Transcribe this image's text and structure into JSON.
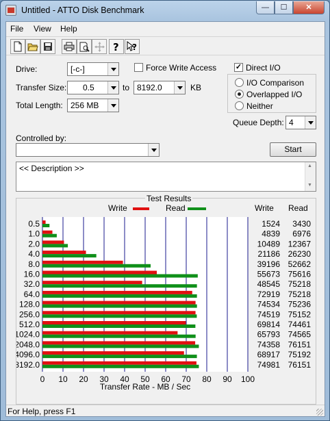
{
  "window": {
    "title": "Untitled - ATTO Disk Benchmark",
    "controls": {
      "minimize": "—",
      "maximize": "☐",
      "close": "✕"
    }
  },
  "menu": [
    "File",
    "View",
    "Help"
  ],
  "toolbar": [
    "new-icon",
    "open-icon",
    "save-icon",
    "print-icon",
    "print-preview-icon",
    "move-icon",
    "help-icon",
    "context-help-icon"
  ],
  "form": {
    "drive_label": "Drive:",
    "drive_value": "[-c-]",
    "transfer_size_label": "Transfer Size:",
    "transfer_from": "0.5",
    "to_label": "to",
    "transfer_to": "8192.0",
    "kb_label": "KB",
    "total_length_label": "Total Length:",
    "total_length_value": "256 MB",
    "force_write_label": "Force Write Access",
    "force_write_checked": false,
    "direct_io_label": "Direct I/O",
    "direct_io_checked": true,
    "radio_options": [
      "I/O Comparison",
      "Overlapped I/O",
      "Neither"
    ],
    "radio_selected": 1,
    "queue_depth_label": "Queue Depth:",
    "queue_depth_value": "4",
    "controlled_by_label": "Controlled by:",
    "controlled_by_value": "",
    "start_label": "Start",
    "description": "<< Description >>"
  },
  "results": {
    "title": "Test Results",
    "write_legend": "Write",
    "read_legend": "Read",
    "write_col": "Write",
    "read_col": "Read"
  },
  "chart_data": {
    "type": "bar",
    "orientation": "horizontal",
    "categories": [
      "0.5",
      "1.0",
      "2.0",
      "4.0",
      "8.0",
      "16.0",
      "32.0",
      "64.0",
      "128.0",
      "256.0",
      "512.0",
      "1024.0",
      "2048.0",
      "4096.0",
      "8192.0"
    ],
    "series": [
      {
        "name": "Write",
        "color": "#e01010",
        "values": [
          1524,
          4839,
          10489,
          21186,
          39196,
          55673,
          48545,
          72919,
          74534,
          74519,
          69814,
          65793,
          74358,
          68917,
          74981
        ]
      },
      {
        "name": "Read",
        "color": "#10901a",
        "values": [
          3430,
          6976,
          12367,
          26230,
          52662,
          75616,
          75218,
          75218,
          75236,
          75152,
          74461,
          74565,
          76151,
          75192,
          76151
        ]
      }
    ],
    "xticks": [
      "0",
      "10",
      "20",
      "30",
      "40",
      "50",
      "60",
      "70",
      "80",
      "90",
      "100"
    ],
    "xlim": [
      0,
      100
    ],
    "value_unit_divisor": 1000,
    "xlabel": "Transfer Rate - MB / Sec",
    "grid_color": "#1a1a8c"
  },
  "status": {
    "text": "For Help, press F1"
  }
}
